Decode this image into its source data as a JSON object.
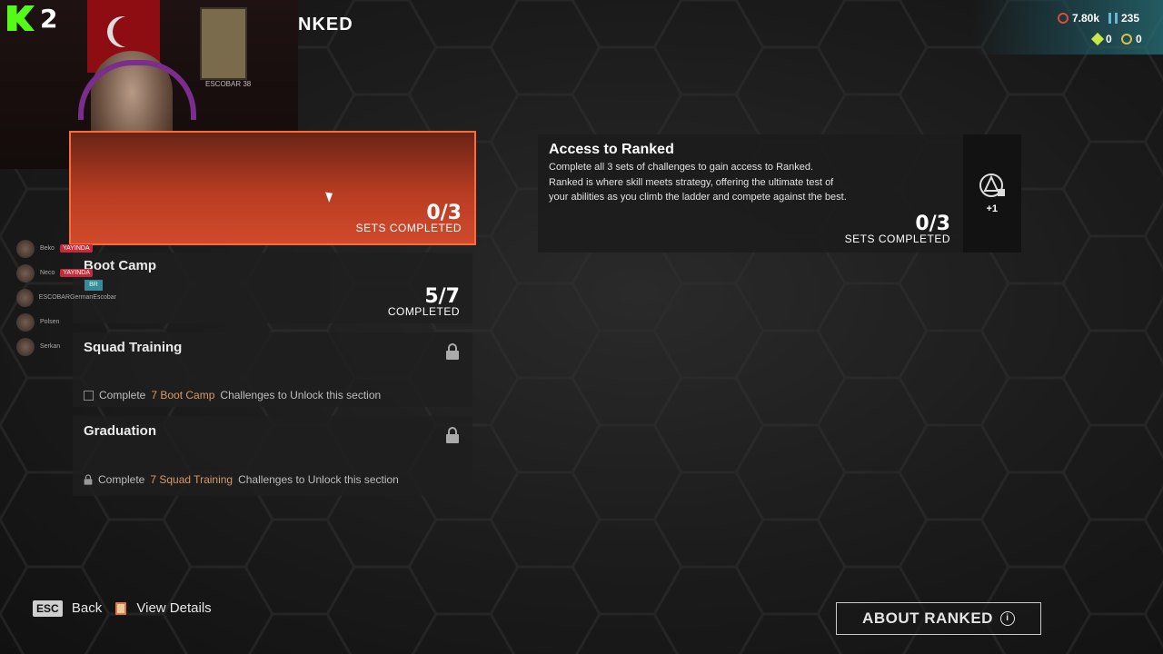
{
  "streamer": {
    "count": "2"
  },
  "webcam": {
    "poster_label": "ESCOBAR 38"
  },
  "header": {
    "title": "NKED"
  },
  "currencies": [
    {
      "icon": "legend-tokens-icon",
      "value": "7.80k",
      "color": "#e04a3a"
    },
    {
      "icon": "crafting-metals-icon",
      "value": "235",
      "color": "#6bb5d8"
    },
    {
      "icon": "exotic-shards-icon",
      "value": "0",
      "color": "#c8e84a"
    },
    {
      "icon": "apex-coins-icon",
      "value": "0",
      "color": "#d8c04a"
    }
  ],
  "squad": [
    {
      "name": "Beko",
      "tag": "YAYINDA"
    },
    {
      "name": "Neco",
      "tag": "YAYINDA"
    },
    {
      "name": "ESCOBARGermanEscobar",
      "tag": ""
    },
    {
      "name": "Polsen",
      "tag": ""
    },
    {
      "name": "Serkan",
      "tag": ""
    }
  ],
  "br_badge": "BR",
  "sections": {
    "selected": {
      "count": "0/3",
      "sub": "SETS COMPLETED"
    },
    "boot_camp": {
      "title": "Boot Camp",
      "count": "5/7",
      "sub": "COMPLETED"
    },
    "squad_training": {
      "title": "Squad Training",
      "note_pre": "Complete",
      "note_hl": "7 Boot Camp",
      "note_post": "Challenges to Unlock this section"
    },
    "graduation": {
      "title": "Graduation",
      "note_pre": "Complete",
      "note_hl": "7 Squad Training",
      "note_post": "Challenges to Unlock this section"
    }
  },
  "access": {
    "title": "Access to Ranked",
    "desc_line1": "Complete all 3 sets of challenges to gain access to Ranked.",
    "desc_line2": "Ranked is where skill meets strategy, offering the ultimate test of your abilities as you climb the ladder and compete against the best.",
    "count": "0/3",
    "sub": "SETS COMPLETED",
    "reward": "+1"
  },
  "footer": {
    "esc_key": "ESC",
    "back_label": "Back",
    "details_label": "View Details",
    "about_label": "ABOUT RANKED",
    "info_glyph": "i"
  }
}
